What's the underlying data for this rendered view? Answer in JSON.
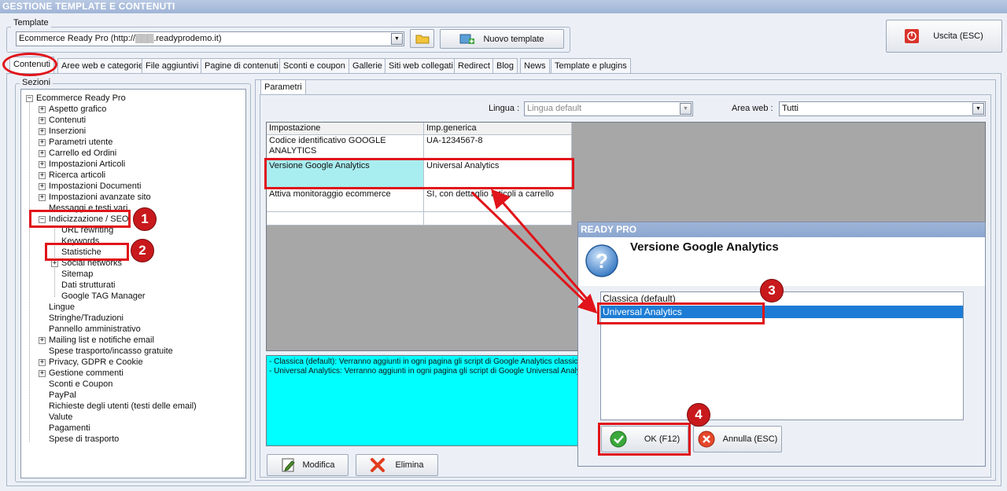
{
  "window": {
    "title": "GESTIONE TEMPLATE E CONTENUTI"
  },
  "template": {
    "label": "Template",
    "value": "Ecommerce Ready Pro (http://▒▒▒.readyprodemo.it)",
    "new_button": "Nuovo template"
  },
  "exit_button": "Uscita (ESC)",
  "tabs": [
    "Contenuti",
    "Aree web e categorie",
    "File aggiuntivi",
    "Pagine di contenuti",
    "Sconti e coupon",
    "Gallerie",
    "Siti web collegati",
    "Redirect",
    "Blog",
    "News",
    "Template e plugins"
  ],
  "sections": {
    "label": "Sezioni",
    "root": "Ecommerce Ready Pro",
    "items": [
      "Aspetto grafico",
      "Contenuti",
      "Inserzioni",
      "Parametri utente",
      "Carrello ed Ordini",
      "Impostazioni Articoli",
      "Ricerca articoli",
      "Impostazioni Documenti",
      "Impostazioni avanzate sito",
      "Messaggi e testi vari",
      "Indicizzazione / SEO"
    ],
    "seo_children": [
      "URL rewriting",
      "Keywords",
      "Statistiche",
      "Social networks",
      "Sitemap",
      "Dati strutturati",
      "Google TAG Manager"
    ],
    "items_after": [
      "Lingue",
      "Stringhe/Traduzioni",
      "Pannello amministrativo",
      "Mailing list e notifiche email",
      "Spese trasporto/incasso gratuite",
      "Privacy, GDPR e Cookie",
      "Gestione commenti",
      "Sconti e Coupon",
      "PayPal",
      "Richieste degli utenti (testi delle email)",
      "Valute",
      "Pagamenti",
      "Spese di trasporto"
    ]
  },
  "params": {
    "tab": "Parametri",
    "lingua_label": "Lingua :",
    "lingua_value": "Lingua default",
    "area_label": "Area web :",
    "area_value": "Tutti",
    "columns": [
      "Impostazione",
      "Imp.generica"
    ],
    "rows": [
      [
        "Codice identificativo GOOGLE ANALYTICS",
        "UA-1234567-8"
      ],
      [
        "Versione Google Analytics",
        "Universal Analytics"
      ],
      [
        "Attiva monitoraggio ecommerce",
        "SI, con dettaglio articoli a carrello"
      ]
    ],
    "description": [
      "- Classica (default): Verranno aggiunti in ogni pagina gli script di Google Analytics classici",
      "- Universal Analytics: Verranno aggiunti in ogni pagina gli script di Google Universal Analytics"
    ],
    "modify_button": "Modifica",
    "delete_button": "Elimina"
  },
  "dialog": {
    "title": "READY PRO",
    "heading": "Versione Google Analytics",
    "options": [
      "Classica (default)",
      "Universal Analytics"
    ],
    "selected_index": 1,
    "ok_button": "OK (F12)",
    "cancel_button": "Annulla (ESC)"
  },
  "badges": [
    "1",
    "2",
    "3",
    "4"
  ],
  "colors": {
    "accent_red": "#e0141a",
    "selection": "#1c7cd5",
    "description_bg": "#00ffff"
  }
}
